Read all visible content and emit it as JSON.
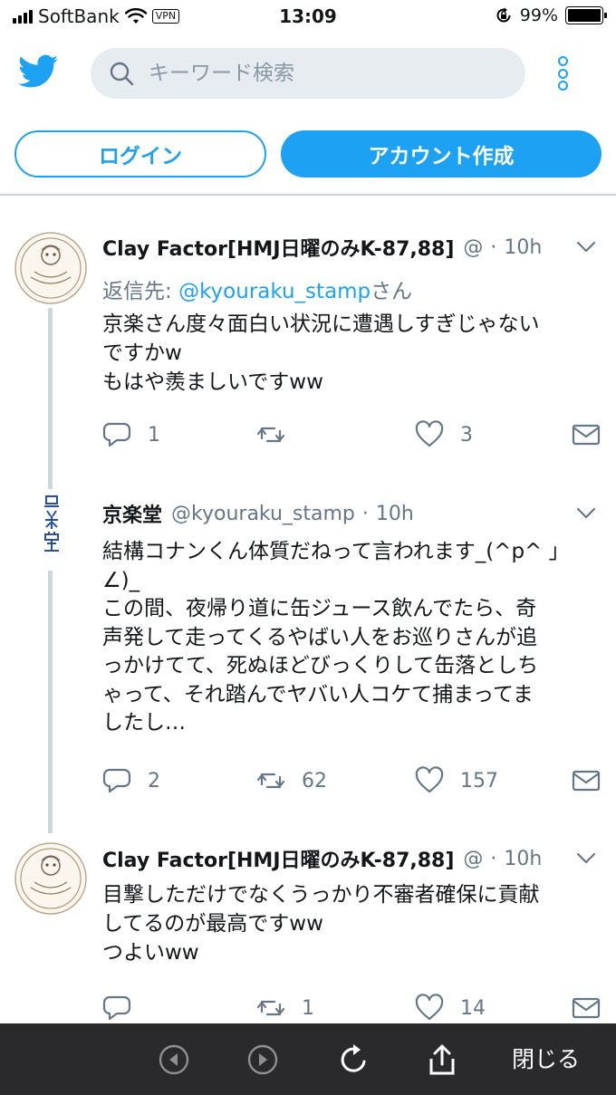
{
  "status_bar": {
    "carrier": "SoftBank",
    "vpn": "VPN",
    "time": "13:09",
    "battery": "99%",
    "battery_level": 0.99
  },
  "header": {
    "search_placeholder": "キーワード検索",
    "login_label": "ログイン",
    "signup_label": "アカウント作成"
  },
  "tweets": [
    {
      "name": "Clay Factor[HMJ日曜のみK-87,88]",
      "handle": "@",
      "separator": "·",
      "time": "10h",
      "reply_prefix": "返信先: ",
      "reply_to": "@kyouraku_stamp",
      "reply_suffix": "さん",
      "lines": [
        "京楽さん度々面白い状況に遭遇しすぎじゃない",
        "ですかw",
        "もはや羨ましいですww"
      ],
      "replies": "1",
      "retweets": "",
      "likes": "3"
    },
    {
      "name": "京楽堂",
      "handle": "@kyouraku_stamp",
      "separator": "·",
      "time": "10h",
      "lines": [
        "結構コナンくん体質だねって言われます_(^p^ 」",
        "∠)_",
        "この間、夜帰り道に缶ジュース飲んでたら、奇",
        "声発して走ってくるやばい人をお巡りさんが追",
        "っかけてて、死ぬほどびっくりして缶落としち",
        "ゃって、それ踏んでヤバい人コケて捕まってま",
        "したし…"
      ],
      "replies": "2",
      "retweets": "62",
      "likes": "157"
    },
    {
      "name": "Clay Factor[HMJ日曜のみK-87,88]",
      "handle": "@",
      "separator": "·",
      "time": "10h",
      "lines": [
        "目撃しただけでなくうっかり不審者確保に貢献",
        "してるのが最高ですww",
        "つよいww"
      ],
      "replies": "",
      "retweets": "1",
      "likes": "14"
    }
  ],
  "toolbar": {
    "close_label": "閉じる"
  },
  "colors": {
    "accent": "#1da1f2",
    "text": "#14171a",
    "secondary": "#657786",
    "toolbar_bg": "#2a2a2c"
  }
}
